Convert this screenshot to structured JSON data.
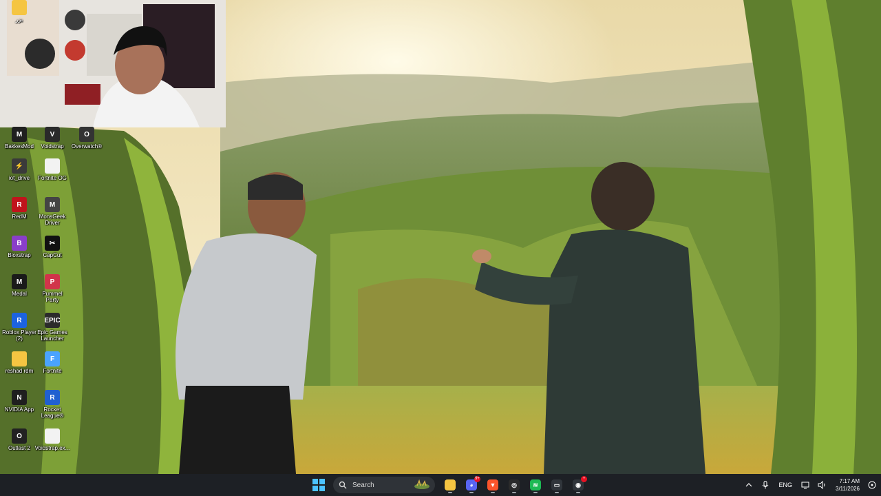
{
  "desktop": {
    "icons": [
      {
        "label": "BakkesMod",
        "icon": "bakkesmod-icon",
        "color": "#1f1f1f",
        "glyph": "M"
      },
      {
        "label": "Voidstrap",
        "icon": "voidstrap-icon",
        "color": "#2a2a2a",
        "glyph": "V"
      },
      {
        "label": "Overwatch®",
        "icon": "overwatch-icon",
        "color": "#333333",
        "glyph": "O"
      },
      {
        "label": "iot_drive",
        "icon": "iot-drive-icon",
        "color": "#3a3a3a",
        "glyph": "⚡"
      },
      {
        "label": "Fortnite OG",
        "icon": "file-icon",
        "color": "#f2f2f2",
        "glyph": ""
      },
      {
        "label": "RedM",
        "icon": "redm-icon",
        "color": "#c0141c",
        "glyph": "R"
      },
      {
        "label": "MonsGeek\nDriver",
        "icon": "monsgeek-icon",
        "color": "#444444",
        "glyph": "M"
      },
      {
        "label": "Bloxstrap",
        "icon": "bloxstrap-icon",
        "color": "#8a3ec9",
        "glyph": "B"
      },
      {
        "label": "CapCut",
        "icon": "capcut-icon",
        "color": "#111111",
        "glyph": "✂"
      },
      {
        "label": "Medal",
        "icon": "medal-icon",
        "color": "#1a1a1a",
        "glyph": "M"
      },
      {
        "label": "Pummel\nParty",
        "icon": "pummel-party-icon",
        "color": "#d1344a",
        "glyph": "P"
      },
      {
        "label": "Roblox Player\n(2)",
        "icon": "roblox-icon",
        "color": "#1c63e0",
        "glyph": "R"
      },
      {
        "label": "Epic Games\nLauncher",
        "icon": "epic-games-icon",
        "color": "#2b2b2b",
        "glyph": "EPIC"
      },
      {
        "label": "reshad rdm",
        "icon": "folder-icon",
        "color": "#f5c542",
        "glyph": ""
      },
      {
        "label": "Fortnite",
        "icon": "fortnite-icon",
        "color": "#4aa3ff",
        "glyph": "F"
      },
      {
        "label": "NVIDIA App",
        "icon": "nvidia-icon",
        "color": "#1f1f1f",
        "glyph": "N"
      },
      {
        "label": "Rocket\nLeague®",
        "icon": "rocket-league-icon",
        "color": "#2060d0",
        "glyph": "R"
      },
      {
        "label": "Outlast 2",
        "icon": "outlast-icon",
        "color": "#222222",
        "glyph": "O"
      },
      {
        "label": "Voidstrap.ex...",
        "icon": "file-icon",
        "color": "#f2f2f2",
        "glyph": ""
      },
      {
        "label": "بزر",
        "icon": "folder-icon",
        "color": "#f5c542",
        "glyph": ""
      }
    ]
  },
  "taskbar": {
    "search_label": "Search",
    "apps": [
      {
        "name": "file-explorer",
        "icon": "folder-icon",
        "color": "#f5c542",
        "glyph": "",
        "badge": ""
      },
      {
        "name": "discord",
        "icon": "discord-icon",
        "color": "#5865f2",
        "glyph": "◕",
        "badge": "9+"
      },
      {
        "name": "brave",
        "icon": "brave-icon",
        "color": "#fb542b",
        "glyph": "▼",
        "badge": ""
      },
      {
        "name": "obs",
        "icon": "obs-icon",
        "color": "#2b2b2b",
        "glyph": "◎",
        "badge": ""
      },
      {
        "name": "spotify",
        "icon": "spotify-icon",
        "color": "#1db954",
        "glyph": "≋",
        "badge": ""
      },
      {
        "name": "screen-tool",
        "icon": "window-icon",
        "color": "#30353b",
        "glyph": "▭",
        "badge": ""
      },
      {
        "name": "recording",
        "icon": "record-icon",
        "color": "#30353b",
        "glyph": "◉",
        "badge": "•"
      }
    ],
    "tray": {
      "language": "ENG",
      "time": "7:17 AM",
      "date": "3/11/2026"
    }
  }
}
